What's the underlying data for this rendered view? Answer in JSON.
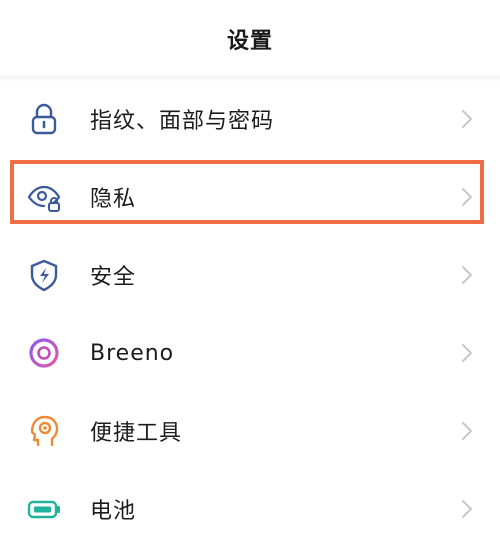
{
  "header": {
    "title": "设置"
  },
  "items": [
    {
      "label": "指纹、面部与密码",
      "icon": "lock-icon",
      "color": "#3c5a9a"
    },
    {
      "label": "隐私",
      "icon": "privacy-eye-lock-icon",
      "color": "#3c5a9a"
    },
    {
      "label": "安全",
      "icon": "shield-bolt-icon",
      "color": "#3c5a9a"
    },
    {
      "label": "Breeno",
      "icon": "breeno-ring-icon",
      "color": "#b04ac8"
    },
    {
      "label": "便捷工具",
      "icon": "head-gear-icon",
      "color": "#f08a32"
    },
    {
      "label": "电池",
      "icon": "battery-icon",
      "color": "#1fb39a"
    }
  ],
  "colors": {
    "highlight_border": "#ee6e46",
    "chevron": "#c8c8c8"
  },
  "annotation": {
    "highlighted_item": "隐私"
  }
}
